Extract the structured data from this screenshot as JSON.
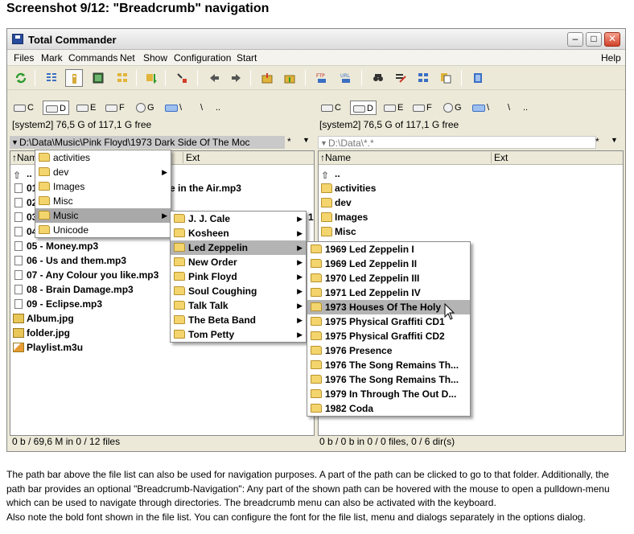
{
  "page_title": "Screenshot 9/12: \"Breadcrumb\" navigation",
  "window": {
    "title": "Total Commander",
    "buttons": [
      "–",
      "□",
      "✕"
    ]
  },
  "menubar": [
    "Files",
    "Mark",
    "Commands",
    "Net",
    "Show",
    "Configuration",
    "Start",
    "Help"
  ],
  "toolbar": {
    "icons": [
      "refresh-icon",
      "brief-view-icon",
      "detailed-view-icon",
      "thumbnails-icon",
      "tree-view-icon",
      "sort-icon",
      "invert-selection-icon",
      "back-icon",
      "forward-icon",
      "pack-icon",
      "unpack-icon",
      "ftp-connect-icon",
      "url-connect-icon",
      "find-icon",
      "multi-rename-icon",
      "sync-dirs-icon",
      "copy-names-icon",
      "notepad-icon"
    ]
  },
  "drives": {
    "left": [
      "C",
      "D",
      "E",
      "F",
      "G",
      "\\",
      ".."
    ],
    "right": [
      "C",
      "D",
      "E",
      "F",
      "G",
      "\\",
      ".."
    ]
  },
  "free_space": {
    "left": "[system2]  76,5 G of 117,1 G free",
    "right": "[system2]  76,5 G of 117,1 G free"
  },
  "path": {
    "left": "D:\\Data\\Music\\Pink Floyd\\1973 Dark Side Of The Moc",
    "right": "D:\\Data\\*.*",
    "star": "*",
    "down": "▼"
  },
  "left_panel": {
    "columns": [
      "Nam",
      "Ext"
    ],
    "rows": [
      "..",
      "01",
      "02",
      "03",
      "04",
      "05 - Money.mp3",
      "06 - Us and them.mp3",
      "07 - Any Colour you like.mp3",
      "08 - Brain Damage.mp3",
      "09 - Eclipse.mp3",
      "Album.jpg",
      "folder.jpg",
      "Playlist.m3u"
    ],
    "partial_visible": [
      "e in the Air.mp3",
      "1"
    ],
    "status": "0 b / 69,6 M in 0 / 12 files"
  },
  "right_panel": {
    "columns": [
      "Name",
      "Ext"
    ],
    "rows": [
      "..",
      "activities",
      "dev",
      "Images",
      "Misc"
    ],
    "status": "0 b / 0 b in 0 / 0 files, 0 / 6 dir(s)"
  },
  "breadcrumb_menu_1": [
    "activities",
    "dev",
    "Images",
    "Misc",
    "Music",
    "Unicode"
  ],
  "breadcrumb_menu_2": [
    "J. J. Cale",
    "Kosheen",
    "Led Zeppelin",
    "New Order",
    "Pink Floyd",
    "Soul Coughing",
    "Talk Talk",
    "The Beta Band",
    "Tom Petty"
  ],
  "breadcrumb_menu_3": [
    "1969 Led Zeppelin I",
    "1969 Led Zeppelin II",
    "1970 Led Zeppelin III",
    "1971 Led Zeppelin IV",
    "1973 Houses Of The Holy",
    "1975 Physical Graffiti CD1",
    "1975 Physical Graffiti CD2",
    "1976 Presence",
    "1976 The Song Remains Th...",
    "1976 The Song Remains Th...",
    "1979 In Through The Out D...",
    "1982 Coda"
  ],
  "description": [
    "The path bar above the file list can also be used for navigation purposes. A part of the path can be clicked to go to that folder. Additionally, the",
    "path bar provides an optional \"Breadcrumb-Navigation\": Any part of the shown path can be hovered with the mouse to open a pulldown-menu",
    "which can be used to navigate through directories. The breadcrumb menu can also be activated with the keyboard.",
    "Also note the bold font shown in the file list. You can configure the font for the file list, menu and dialogs separately in the options dialog."
  ],
  "colors": {
    "folder": "#f4d56d",
    "highlight": "#b4b4b4",
    "window_bg": "#ece9d8"
  }
}
